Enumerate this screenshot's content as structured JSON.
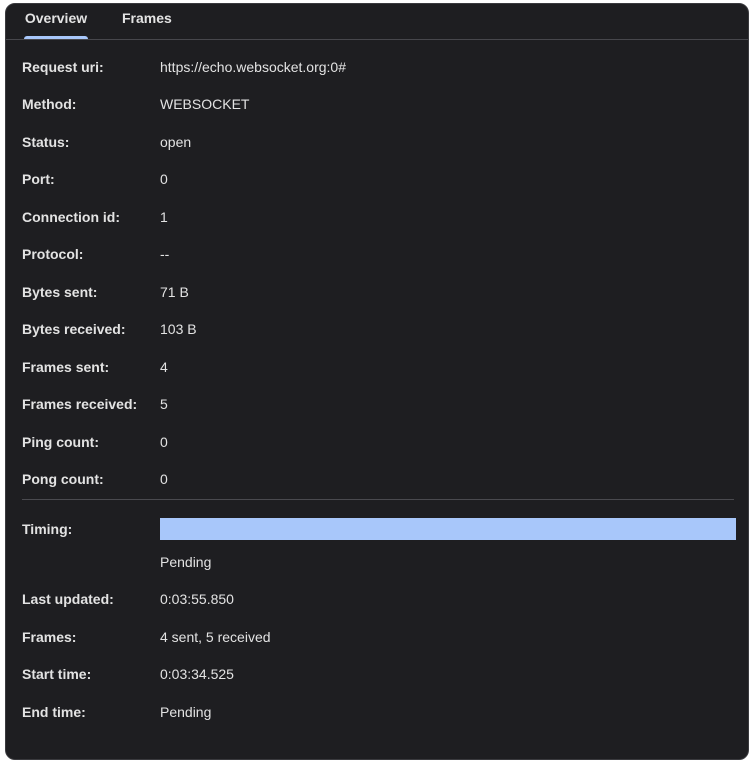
{
  "tabs": {
    "overview": "Overview",
    "frames": "Frames"
  },
  "overview": {
    "request_uri_label": "Request uri:",
    "request_uri": "https://echo.websocket.org:0#",
    "method_label": "Method:",
    "method": "WEBSOCKET",
    "status_label": "Status:",
    "status": "open",
    "port_label": "Port:",
    "port": "0",
    "connection_id_label": "Connection id:",
    "connection_id": "1",
    "protocol_label": "Protocol:",
    "protocol": "--",
    "bytes_sent_label": "Bytes sent:",
    "bytes_sent": "71 B",
    "bytes_received_label": "Bytes received:",
    "bytes_received": "103 B",
    "frames_sent_label": "Frames sent:",
    "frames_sent": "4",
    "frames_received_label": "Frames received:",
    "frames_received": "5",
    "ping_count_label": "Ping count:",
    "ping_count": "0",
    "pong_count_label": "Pong count:",
    "pong_count": "0"
  },
  "timing": {
    "timing_label": "Timing:",
    "bar_color": "#a8c7fa",
    "timing_status": "Pending",
    "last_updated_label": "Last updated:",
    "last_updated": "0:03:55.850",
    "frames_label": "Frames:",
    "frames": "4 sent, 5 received",
    "start_time_label": "Start time:",
    "start_time": "0:03:34.525",
    "end_time_label": "End time:",
    "end_time": "Pending"
  },
  "colors": {
    "background": "#1e1e21",
    "accent": "#a8c7fa",
    "text": "#e3e3e3"
  }
}
